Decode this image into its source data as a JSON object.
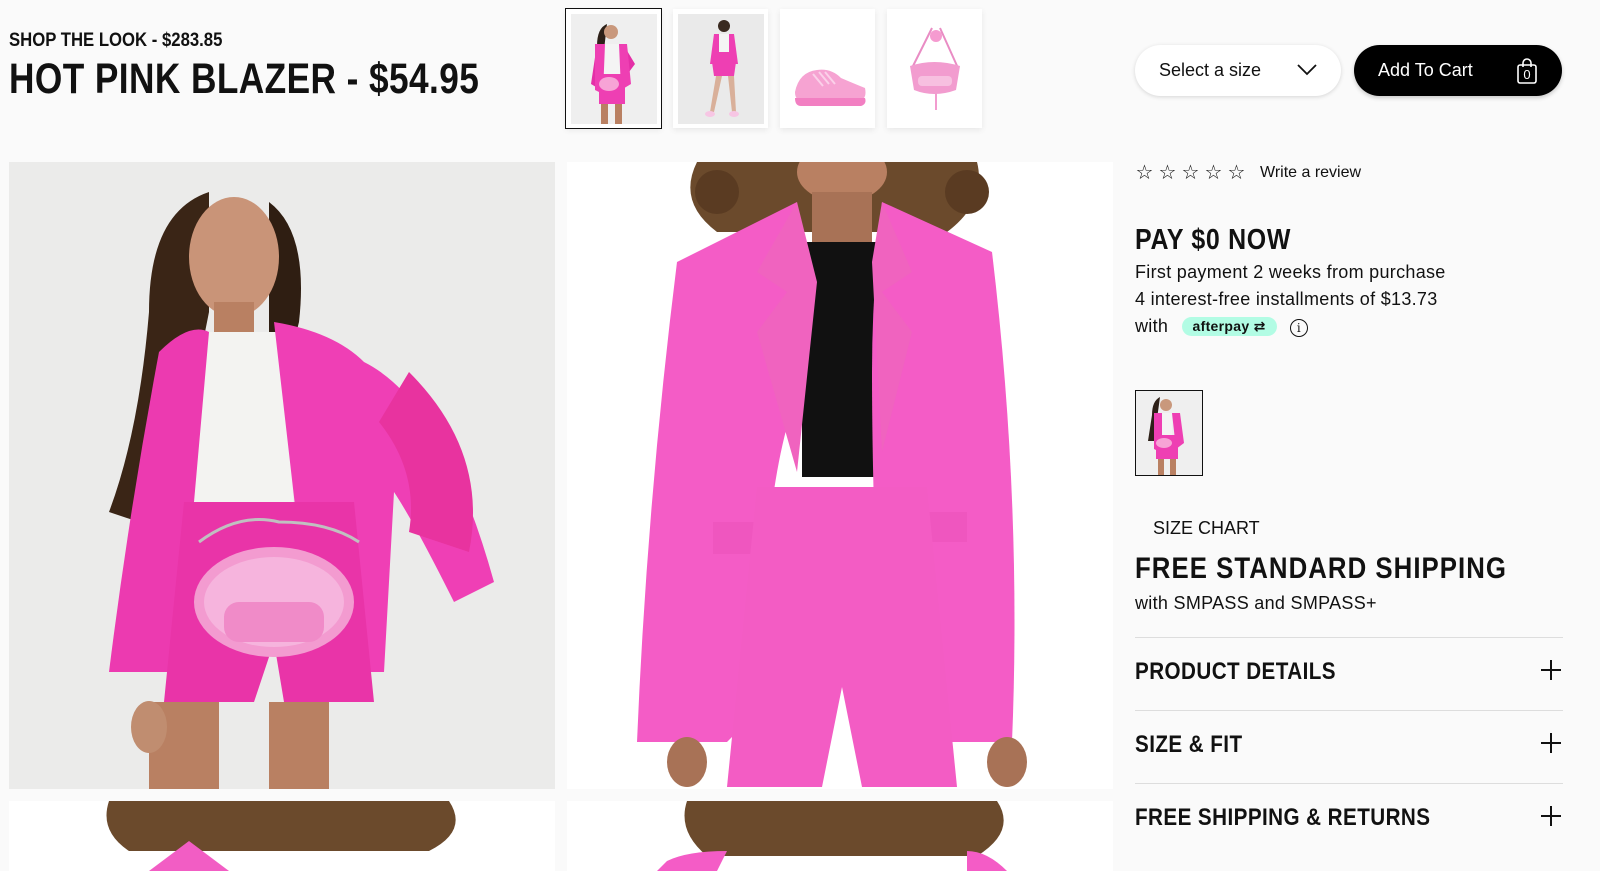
{
  "look": {
    "subtitle": "SHOP THE LOOK - $283.85",
    "title": "HOT PINK BLAZER - $54.95"
  },
  "thumbnails": [
    {
      "name": "blazer-model-front",
      "active": true
    },
    {
      "name": "blazer-model-full",
      "active": false
    },
    {
      "name": "pink-sneaker",
      "active": false
    },
    {
      "name": "pink-belt-bag",
      "active": false
    }
  ],
  "purchase": {
    "size_placeholder": "Select a size",
    "add_to_cart_label": "Add To Cart",
    "cart_count": "0"
  },
  "reviews": {
    "star_count": 5,
    "write_review_label": "Write a review"
  },
  "payment": {
    "title": "PAY $0 NOW",
    "line1": "First payment 2 weeks from purchase",
    "line2": "4 interest-free installments of $13.73",
    "line3_prefix": "with",
    "provider": "afterpay",
    "info_icon": "i"
  },
  "size_chart_label": "SIZE CHART",
  "shipping": {
    "title": "FREE STANDARD SHIPPING",
    "subtitle": "with SMPASS and SMPASS+"
  },
  "accordions": [
    {
      "label": "PRODUCT DETAILS"
    },
    {
      "label": "SIZE & FIT"
    },
    {
      "label": "FREE SHIPPING & RETURNS"
    }
  ],
  "colors": {
    "hot_pink": "#f33fb7",
    "light_pink": "#f45cc6",
    "afterpay_mint": "#b2fce4",
    "black": "#000000"
  }
}
